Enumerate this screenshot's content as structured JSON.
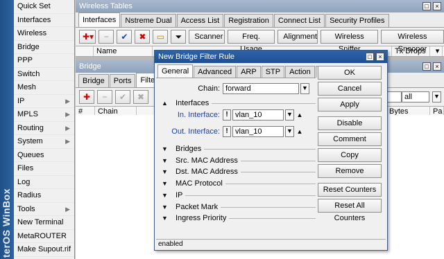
{
  "brand": "terOS WinBox",
  "menu": [
    {
      "label": "Quick Set",
      "arrow": false
    },
    {
      "label": "Interfaces",
      "arrow": false
    },
    {
      "label": "Wireless",
      "arrow": false
    },
    {
      "label": "Bridge",
      "arrow": false
    },
    {
      "label": "PPP",
      "arrow": false
    },
    {
      "label": "Switch",
      "arrow": false
    },
    {
      "label": "Mesh",
      "arrow": false
    },
    {
      "label": "IP",
      "arrow": true
    },
    {
      "label": "MPLS",
      "arrow": true
    },
    {
      "label": "Routing",
      "arrow": true
    },
    {
      "label": "System",
      "arrow": true
    },
    {
      "label": "Queues",
      "arrow": false
    },
    {
      "label": "Files",
      "arrow": false
    },
    {
      "label": "Log",
      "arrow": false
    },
    {
      "label": "Radius",
      "arrow": false
    },
    {
      "label": "Tools",
      "arrow": true
    },
    {
      "label": "New Terminal",
      "arrow": false
    },
    {
      "label": "MetaROUTER",
      "arrow": false
    },
    {
      "label": "Make Supout.rif",
      "arrow": false
    }
  ],
  "wireless": {
    "title": "Wireless Tables",
    "tabs": [
      "Interfaces",
      "Nstreme Dual",
      "Access List",
      "Registration",
      "Connect List",
      "Security Profiles"
    ],
    "toolbar": [
      "Scanner",
      "Freq. Usage",
      "Alignment",
      "Wireless Sniffer",
      "Wireless Snooper"
    ],
    "columns": [
      "Name",
      "Tx Drops"
    ]
  },
  "bridge": {
    "title": "Bridge",
    "tabs": [
      "Bridge",
      "Ports",
      "Filters"
    ],
    "columns": [
      "#",
      "Chain",
      "Bytes",
      "Pa"
    ],
    "filter": "all"
  },
  "dialog": {
    "title": "New Bridge Filter Rule",
    "tabs": [
      "General",
      "Advanced",
      "ARP",
      "STP",
      "Action",
      "..."
    ],
    "chain_label": "Chain:",
    "chain_value": "forward",
    "interfaces_label": "Interfaces",
    "in_label": "In. Interface:",
    "in_value": "vlan_10",
    "out_label": "Out. Interface:",
    "out_value": "vlan_10",
    "sections": [
      "Bridges",
      "Src. MAC Address",
      "Dst. MAC Address",
      "MAC Protocol",
      "IP",
      "Packet Mark",
      "Ingress Priority"
    ],
    "buttons": [
      "OK",
      "Cancel",
      "Apply",
      "Disable",
      "Comment",
      "Copy",
      "Remove",
      "Reset Counters",
      "Reset All Counters"
    ],
    "status": "enabled"
  }
}
